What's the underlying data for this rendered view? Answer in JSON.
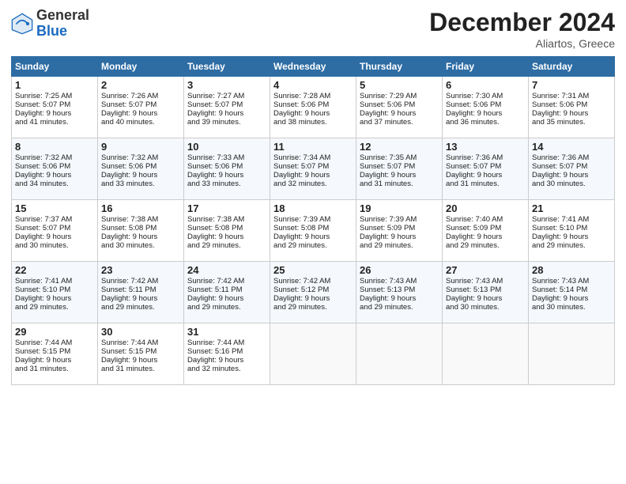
{
  "header": {
    "logo_general": "General",
    "logo_blue": "Blue",
    "month_title": "December 2024",
    "location": "Aliartos, Greece"
  },
  "weekdays": [
    "Sunday",
    "Monday",
    "Tuesday",
    "Wednesday",
    "Thursday",
    "Friday",
    "Saturday"
  ],
  "weeks": [
    [
      {
        "day": "1",
        "lines": [
          "Sunrise: 7:25 AM",
          "Sunset: 5:07 PM",
          "Daylight: 9 hours",
          "and 41 minutes."
        ]
      },
      {
        "day": "2",
        "lines": [
          "Sunrise: 7:26 AM",
          "Sunset: 5:07 PM",
          "Daylight: 9 hours",
          "and 40 minutes."
        ]
      },
      {
        "day": "3",
        "lines": [
          "Sunrise: 7:27 AM",
          "Sunset: 5:07 PM",
          "Daylight: 9 hours",
          "and 39 minutes."
        ]
      },
      {
        "day": "4",
        "lines": [
          "Sunrise: 7:28 AM",
          "Sunset: 5:06 PM",
          "Daylight: 9 hours",
          "and 38 minutes."
        ]
      },
      {
        "day": "5",
        "lines": [
          "Sunrise: 7:29 AM",
          "Sunset: 5:06 PM",
          "Daylight: 9 hours",
          "and 37 minutes."
        ]
      },
      {
        "day": "6",
        "lines": [
          "Sunrise: 7:30 AM",
          "Sunset: 5:06 PM",
          "Daylight: 9 hours",
          "and 36 minutes."
        ]
      },
      {
        "day": "7",
        "lines": [
          "Sunrise: 7:31 AM",
          "Sunset: 5:06 PM",
          "Daylight: 9 hours",
          "and 35 minutes."
        ]
      }
    ],
    [
      {
        "day": "8",
        "lines": [
          "Sunrise: 7:32 AM",
          "Sunset: 5:06 PM",
          "Daylight: 9 hours",
          "and 34 minutes."
        ]
      },
      {
        "day": "9",
        "lines": [
          "Sunrise: 7:32 AM",
          "Sunset: 5:06 PM",
          "Daylight: 9 hours",
          "and 33 minutes."
        ]
      },
      {
        "day": "10",
        "lines": [
          "Sunrise: 7:33 AM",
          "Sunset: 5:06 PM",
          "Daylight: 9 hours",
          "and 33 minutes."
        ]
      },
      {
        "day": "11",
        "lines": [
          "Sunrise: 7:34 AM",
          "Sunset: 5:07 PM",
          "Daylight: 9 hours",
          "and 32 minutes."
        ]
      },
      {
        "day": "12",
        "lines": [
          "Sunrise: 7:35 AM",
          "Sunset: 5:07 PM",
          "Daylight: 9 hours",
          "and 31 minutes."
        ]
      },
      {
        "day": "13",
        "lines": [
          "Sunrise: 7:36 AM",
          "Sunset: 5:07 PM",
          "Daylight: 9 hours",
          "and 31 minutes."
        ]
      },
      {
        "day": "14",
        "lines": [
          "Sunrise: 7:36 AM",
          "Sunset: 5:07 PM",
          "Daylight: 9 hours",
          "and 30 minutes."
        ]
      }
    ],
    [
      {
        "day": "15",
        "lines": [
          "Sunrise: 7:37 AM",
          "Sunset: 5:07 PM",
          "Daylight: 9 hours",
          "and 30 minutes."
        ]
      },
      {
        "day": "16",
        "lines": [
          "Sunrise: 7:38 AM",
          "Sunset: 5:08 PM",
          "Daylight: 9 hours",
          "and 30 minutes."
        ]
      },
      {
        "day": "17",
        "lines": [
          "Sunrise: 7:38 AM",
          "Sunset: 5:08 PM",
          "Daylight: 9 hours",
          "and 29 minutes."
        ]
      },
      {
        "day": "18",
        "lines": [
          "Sunrise: 7:39 AM",
          "Sunset: 5:08 PM",
          "Daylight: 9 hours",
          "and 29 minutes."
        ]
      },
      {
        "day": "19",
        "lines": [
          "Sunrise: 7:39 AM",
          "Sunset: 5:09 PM",
          "Daylight: 9 hours",
          "and 29 minutes."
        ]
      },
      {
        "day": "20",
        "lines": [
          "Sunrise: 7:40 AM",
          "Sunset: 5:09 PM",
          "Daylight: 9 hours",
          "and 29 minutes."
        ]
      },
      {
        "day": "21",
        "lines": [
          "Sunrise: 7:41 AM",
          "Sunset: 5:10 PM",
          "Daylight: 9 hours",
          "and 29 minutes."
        ]
      }
    ],
    [
      {
        "day": "22",
        "lines": [
          "Sunrise: 7:41 AM",
          "Sunset: 5:10 PM",
          "Daylight: 9 hours",
          "and 29 minutes."
        ]
      },
      {
        "day": "23",
        "lines": [
          "Sunrise: 7:42 AM",
          "Sunset: 5:11 PM",
          "Daylight: 9 hours",
          "and 29 minutes."
        ]
      },
      {
        "day": "24",
        "lines": [
          "Sunrise: 7:42 AM",
          "Sunset: 5:11 PM",
          "Daylight: 9 hours",
          "and 29 minutes."
        ]
      },
      {
        "day": "25",
        "lines": [
          "Sunrise: 7:42 AM",
          "Sunset: 5:12 PM",
          "Daylight: 9 hours",
          "and 29 minutes."
        ]
      },
      {
        "day": "26",
        "lines": [
          "Sunrise: 7:43 AM",
          "Sunset: 5:13 PM",
          "Daylight: 9 hours",
          "and 29 minutes."
        ]
      },
      {
        "day": "27",
        "lines": [
          "Sunrise: 7:43 AM",
          "Sunset: 5:13 PM",
          "Daylight: 9 hours",
          "and 30 minutes."
        ]
      },
      {
        "day": "28",
        "lines": [
          "Sunrise: 7:43 AM",
          "Sunset: 5:14 PM",
          "Daylight: 9 hours",
          "and 30 minutes."
        ]
      }
    ],
    [
      {
        "day": "29",
        "lines": [
          "Sunrise: 7:44 AM",
          "Sunset: 5:15 PM",
          "Daylight: 9 hours",
          "and 31 minutes."
        ]
      },
      {
        "day": "30",
        "lines": [
          "Sunrise: 7:44 AM",
          "Sunset: 5:15 PM",
          "Daylight: 9 hours",
          "and 31 minutes."
        ]
      },
      {
        "day": "31",
        "lines": [
          "Sunrise: 7:44 AM",
          "Sunset: 5:16 PM",
          "Daylight: 9 hours",
          "and 32 minutes."
        ]
      },
      null,
      null,
      null,
      null
    ]
  ]
}
